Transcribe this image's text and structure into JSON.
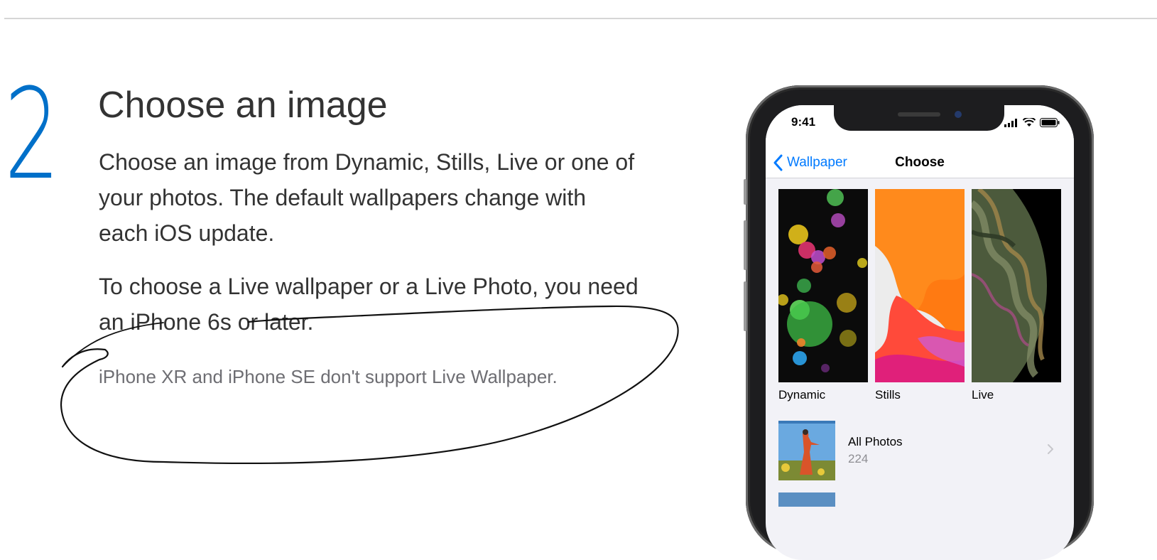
{
  "step": {
    "number": "2"
  },
  "heading": "Choose an image",
  "paragraphs": [
    "Choose an image from Dynamic, Stills, Live or one of your photos. The default wallpapers change with each iOS update.",
    "To choose a Live wallpaper or a Live Photo, you need an iPhone 6s or later."
  ],
  "note": "iPhone XR and iPhone SE don't support Live Wallpaper.",
  "phone": {
    "status": {
      "time": "9:41",
      "icons": [
        "signal-icon",
        "wifi-icon",
        "battery-icon"
      ]
    },
    "nav": {
      "back_label": "Wallpaper",
      "title": "Choose"
    },
    "categories": [
      {
        "label": "Dynamic"
      },
      {
        "label": "Stills"
      },
      {
        "label": "Live"
      }
    ],
    "albums": [
      {
        "title": "All Photos",
        "count": "224"
      }
    ]
  },
  "colors": {
    "accent": "#0070c9",
    "ios_blue": "#007aff",
    "text": "#333333",
    "note": "#6e6e73"
  }
}
